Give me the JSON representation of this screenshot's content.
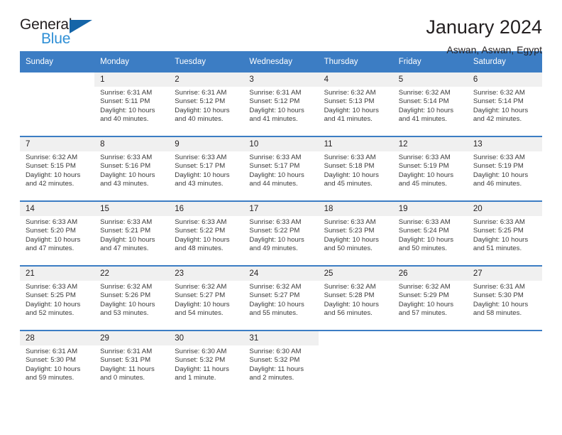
{
  "brand": {
    "name_top": "General",
    "name_bottom": "Blue",
    "accent_dark": "#1565a8",
    "accent_light": "#2e8fd6"
  },
  "header": {
    "title": "January 2024",
    "location": "Aswan, Aswan, Egypt",
    "header_bg": "#3c7dc4",
    "daynum_bg": "#f0f0f0"
  },
  "weekday_headers": [
    "Sunday",
    "Monday",
    "Tuesday",
    "Wednesday",
    "Thursday",
    "Friday",
    "Saturday"
  ],
  "labels": {
    "sunrise_prefix": "Sunrise:",
    "sunset_prefix": "Sunset:",
    "daylight_prefix": "Daylight:"
  },
  "weeks": [
    [
      {
        "day": "",
        "sunrise": "",
        "sunset": "",
        "daylight_1": "",
        "daylight_2": ""
      },
      {
        "day": "1",
        "sunrise": "Sunrise: 6:31 AM",
        "sunset": "Sunset: 5:11 PM",
        "daylight_1": "Daylight: 10 hours",
        "daylight_2": "and 40 minutes."
      },
      {
        "day": "2",
        "sunrise": "Sunrise: 6:31 AM",
        "sunset": "Sunset: 5:12 PM",
        "daylight_1": "Daylight: 10 hours",
        "daylight_2": "and 40 minutes."
      },
      {
        "day": "3",
        "sunrise": "Sunrise: 6:31 AM",
        "sunset": "Sunset: 5:12 PM",
        "daylight_1": "Daylight: 10 hours",
        "daylight_2": "and 41 minutes."
      },
      {
        "day": "4",
        "sunrise": "Sunrise: 6:32 AM",
        "sunset": "Sunset: 5:13 PM",
        "daylight_1": "Daylight: 10 hours",
        "daylight_2": "and 41 minutes."
      },
      {
        "day": "5",
        "sunrise": "Sunrise: 6:32 AM",
        "sunset": "Sunset: 5:14 PM",
        "daylight_1": "Daylight: 10 hours",
        "daylight_2": "and 41 minutes."
      },
      {
        "day": "6",
        "sunrise": "Sunrise: 6:32 AM",
        "sunset": "Sunset: 5:14 PM",
        "daylight_1": "Daylight: 10 hours",
        "daylight_2": "and 42 minutes."
      }
    ],
    [
      {
        "day": "7",
        "sunrise": "Sunrise: 6:32 AM",
        "sunset": "Sunset: 5:15 PM",
        "daylight_1": "Daylight: 10 hours",
        "daylight_2": "and 42 minutes."
      },
      {
        "day": "8",
        "sunrise": "Sunrise: 6:33 AM",
        "sunset": "Sunset: 5:16 PM",
        "daylight_1": "Daylight: 10 hours",
        "daylight_2": "and 43 minutes."
      },
      {
        "day": "9",
        "sunrise": "Sunrise: 6:33 AM",
        "sunset": "Sunset: 5:17 PM",
        "daylight_1": "Daylight: 10 hours",
        "daylight_2": "and 43 minutes."
      },
      {
        "day": "10",
        "sunrise": "Sunrise: 6:33 AM",
        "sunset": "Sunset: 5:17 PM",
        "daylight_1": "Daylight: 10 hours",
        "daylight_2": "and 44 minutes."
      },
      {
        "day": "11",
        "sunrise": "Sunrise: 6:33 AM",
        "sunset": "Sunset: 5:18 PM",
        "daylight_1": "Daylight: 10 hours",
        "daylight_2": "and 45 minutes."
      },
      {
        "day": "12",
        "sunrise": "Sunrise: 6:33 AM",
        "sunset": "Sunset: 5:19 PM",
        "daylight_1": "Daylight: 10 hours",
        "daylight_2": "and 45 minutes."
      },
      {
        "day": "13",
        "sunrise": "Sunrise: 6:33 AM",
        "sunset": "Sunset: 5:19 PM",
        "daylight_1": "Daylight: 10 hours",
        "daylight_2": "and 46 minutes."
      }
    ],
    [
      {
        "day": "14",
        "sunrise": "Sunrise: 6:33 AM",
        "sunset": "Sunset: 5:20 PM",
        "daylight_1": "Daylight: 10 hours",
        "daylight_2": "and 47 minutes."
      },
      {
        "day": "15",
        "sunrise": "Sunrise: 6:33 AM",
        "sunset": "Sunset: 5:21 PM",
        "daylight_1": "Daylight: 10 hours",
        "daylight_2": "and 47 minutes."
      },
      {
        "day": "16",
        "sunrise": "Sunrise: 6:33 AM",
        "sunset": "Sunset: 5:22 PM",
        "daylight_1": "Daylight: 10 hours",
        "daylight_2": "and 48 minutes."
      },
      {
        "day": "17",
        "sunrise": "Sunrise: 6:33 AM",
        "sunset": "Sunset: 5:22 PM",
        "daylight_1": "Daylight: 10 hours",
        "daylight_2": "and 49 minutes."
      },
      {
        "day": "18",
        "sunrise": "Sunrise: 6:33 AM",
        "sunset": "Sunset: 5:23 PM",
        "daylight_1": "Daylight: 10 hours",
        "daylight_2": "and 50 minutes."
      },
      {
        "day": "19",
        "sunrise": "Sunrise: 6:33 AM",
        "sunset": "Sunset: 5:24 PM",
        "daylight_1": "Daylight: 10 hours",
        "daylight_2": "and 50 minutes."
      },
      {
        "day": "20",
        "sunrise": "Sunrise: 6:33 AM",
        "sunset": "Sunset: 5:25 PM",
        "daylight_1": "Daylight: 10 hours",
        "daylight_2": "and 51 minutes."
      }
    ],
    [
      {
        "day": "21",
        "sunrise": "Sunrise: 6:33 AM",
        "sunset": "Sunset: 5:25 PM",
        "daylight_1": "Daylight: 10 hours",
        "daylight_2": "and 52 minutes."
      },
      {
        "day": "22",
        "sunrise": "Sunrise: 6:32 AM",
        "sunset": "Sunset: 5:26 PM",
        "daylight_1": "Daylight: 10 hours",
        "daylight_2": "and 53 minutes."
      },
      {
        "day": "23",
        "sunrise": "Sunrise: 6:32 AM",
        "sunset": "Sunset: 5:27 PM",
        "daylight_1": "Daylight: 10 hours",
        "daylight_2": "and 54 minutes."
      },
      {
        "day": "24",
        "sunrise": "Sunrise: 6:32 AM",
        "sunset": "Sunset: 5:27 PM",
        "daylight_1": "Daylight: 10 hours",
        "daylight_2": "and 55 minutes."
      },
      {
        "day": "25",
        "sunrise": "Sunrise: 6:32 AM",
        "sunset": "Sunset: 5:28 PM",
        "daylight_1": "Daylight: 10 hours",
        "daylight_2": "and 56 minutes."
      },
      {
        "day": "26",
        "sunrise": "Sunrise: 6:32 AM",
        "sunset": "Sunset: 5:29 PM",
        "daylight_1": "Daylight: 10 hours",
        "daylight_2": "and 57 minutes."
      },
      {
        "day": "27",
        "sunrise": "Sunrise: 6:31 AM",
        "sunset": "Sunset: 5:30 PM",
        "daylight_1": "Daylight: 10 hours",
        "daylight_2": "and 58 minutes."
      }
    ],
    [
      {
        "day": "28",
        "sunrise": "Sunrise: 6:31 AM",
        "sunset": "Sunset: 5:30 PM",
        "daylight_1": "Daylight: 10 hours",
        "daylight_2": "and 59 minutes."
      },
      {
        "day": "29",
        "sunrise": "Sunrise: 6:31 AM",
        "sunset": "Sunset: 5:31 PM",
        "daylight_1": "Daylight: 11 hours",
        "daylight_2": "and 0 minutes."
      },
      {
        "day": "30",
        "sunrise": "Sunrise: 6:30 AM",
        "sunset": "Sunset: 5:32 PM",
        "daylight_1": "Daylight: 11 hours",
        "daylight_2": "and 1 minute."
      },
      {
        "day": "31",
        "sunrise": "Sunrise: 6:30 AM",
        "sunset": "Sunset: 5:32 PM",
        "daylight_1": "Daylight: 11 hours",
        "daylight_2": "and 2 minutes."
      },
      {
        "day": "",
        "sunrise": "",
        "sunset": "",
        "daylight_1": "",
        "daylight_2": ""
      },
      {
        "day": "",
        "sunrise": "",
        "sunset": "",
        "daylight_1": "",
        "daylight_2": ""
      },
      {
        "day": "",
        "sunrise": "",
        "sunset": "",
        "daylight_1": "",
        "daylight_2": ""
      }
    ]
  ]
}
